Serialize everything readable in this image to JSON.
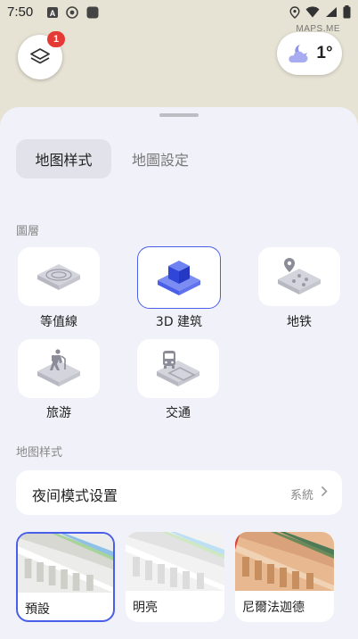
{
  "status": {
    "time": "7:50"
  },
  "map": {
    "watermark": "MAPS.ME",
    "layers_badge": "1",
    "temperature": "1°"
  },
  "tabs": {
    "active": "地图样式",
    "inactive": "地圖設定"
  },
  "layers_section": {
    "label": "圖層",
    "items": [
      {
        "label": "等值線",
        "icon": "contour-lines-icon",
        "selected": false
      },
      {
        "label": "3D 建筑",
        "icon": "3d-buildings-icon",
        "selected": true
      },
      {
        "label": "地铁",
        "icon": "subway-icon",
        "selected": false
      },
      {
        "label": "旅游",
        "icon": "hiking-icon",
        "selected": false
      },
      {
        "label": "交通",
        "icon": "bus-icon",
        "selected": false
      }
    ]
  },
  "style_section": {
    "label": "地图样式",
    "night_mode": {
      "title": "夜间模式设置",
      "value": "系統"
    },
    "styles": [
      {
        "label": "預設",
        "selected": true
      },
      {
        "label": "明亮",
        "selected": false
      },
      {
        "label": "尼爾法迦德",
        "selected": false
      }
    ]
  },
  "colors": {
    "accent": "#4a5fe8",
    "badge": "#e53935",
    "sheet_bg": "#f1f1f9",
    "map_bg": "#e6e2d4"
  }
}
